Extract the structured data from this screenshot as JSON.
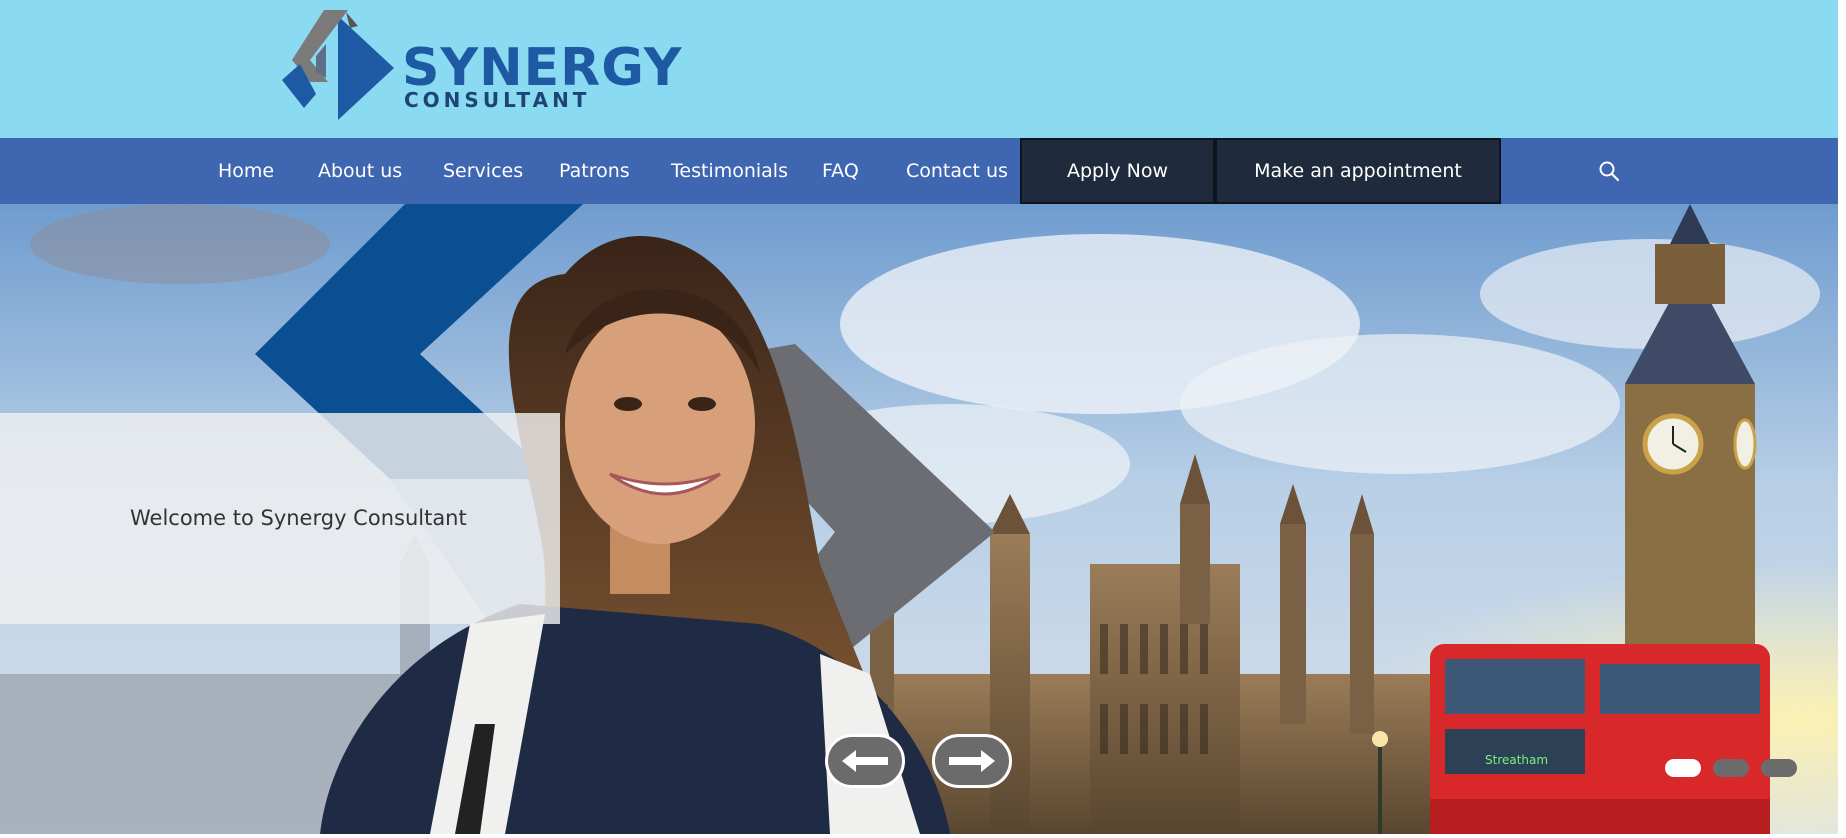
{
  "header": {
    "logo_line1": "SYNERGY",
    "logo_line2": "CONSULTANT",
    "background": "#8adaf2"
  },
  "nav": {
    "items": [
      {
        "label": "Home"
      },
      {
        "label": "About us"
      },
      {
        "label": "Services"
      },
      {
        "label": "Patrons"
      },
      {
        "label": "Testimonials"
      },
      {
        "label": "FAQ"
      },
      {
        "label": "Contact us"
      }
    ],
    "apply_label": "Apply Now",
    "appointment_label": "Make an appointment",
    "search_icon": "search-icon",
    "background": "#3e66b1",
    "cta_background": "#1f2a3c"
  },
  "hero": {
    "welcome_text": "Welcome to Synergy Consultant",
    "prev_icon": "arrow-left-icon",
    "next_icon": "arrow-right-icon",
    "slides_total": 3,
    "active_slide": 1,
    "bus_sign": "Streatham"
  }
}
